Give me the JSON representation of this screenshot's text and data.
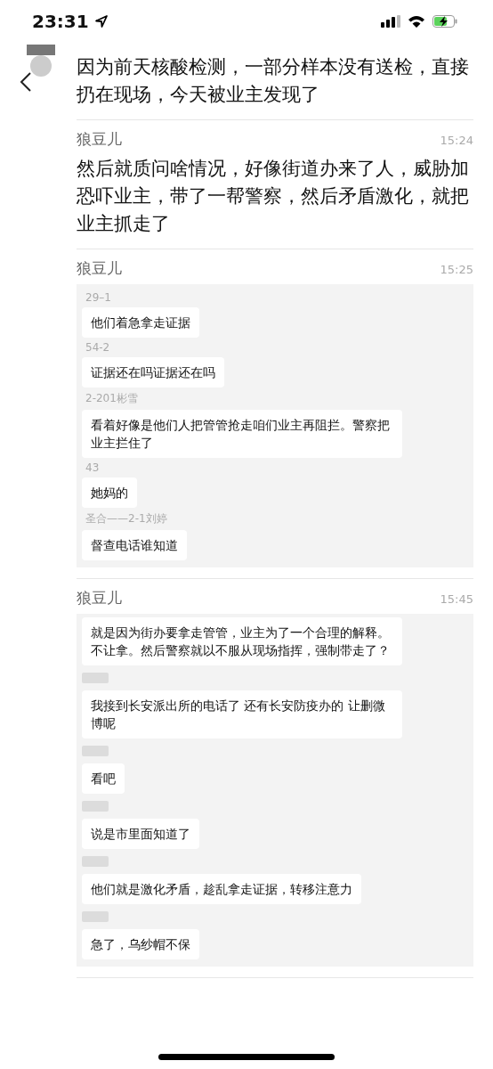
{
  "status_bar": {
    "time": "23:31"
  },
  "messages": [
    {
      "kind": "text",
      "text": "因为前天核酸检测，一部分样本没有送检，直接扔在现场，今天被业主发现了"
    },
    {
      "kind": "text",
      "sender": "狼豆儿",
      "time": "15:24",
      "text": "然后就质问啥情况，好像街道办来了人，威胁加恐吓业主，带了一帮警察，然后矛盾激化，就把业主抓走了"
    },
    {
      "kind": "record",
      "sender": "狼豆儿",
      "time": "15:25",
      "items": [
        {
          "sender": "29–1",
          "text": "他们着急拿走证据"
        },
        {
          "sender": "54-2",
          "text": "证据还在吗证据还在吗"
        },
        {
          "sender": "2-201彬雪",
          "text": "看着好像是他们人把管管抢走咱们业主再阻拦。警察把业主拦住了"
        },
        {
          "sender": "43",
          "text": "她妈的"
        },
        {
          "sender": "圣合——2-1刘婷",
          "text": "督查电话谁知道"
        }
      ]
    },
    {
      "kind": "record",
      "sender": "狼豆儿",
      "time": "15:45",
      "items": [
        {
          "text": "就是因为街办要拿走管管，业主为了一个合理的解释。不让拿。然后警察就以不服从现场指挥，强制带走了？"
        },
        {
          "text": "我接到长安派出所的电话了 还有长安防疫办的 让删微博呢"
        },
        {
          "text": "看吧"
        },
        {
          "text": "说是市里面知道了"
        },
        {
          "text": "他们就是激化矛盾，趁乱拿走证据，转移注意力"
        },
        {
          "text": "急了，乌纱帽不保"
        }
      ]
    }
  ]
}
